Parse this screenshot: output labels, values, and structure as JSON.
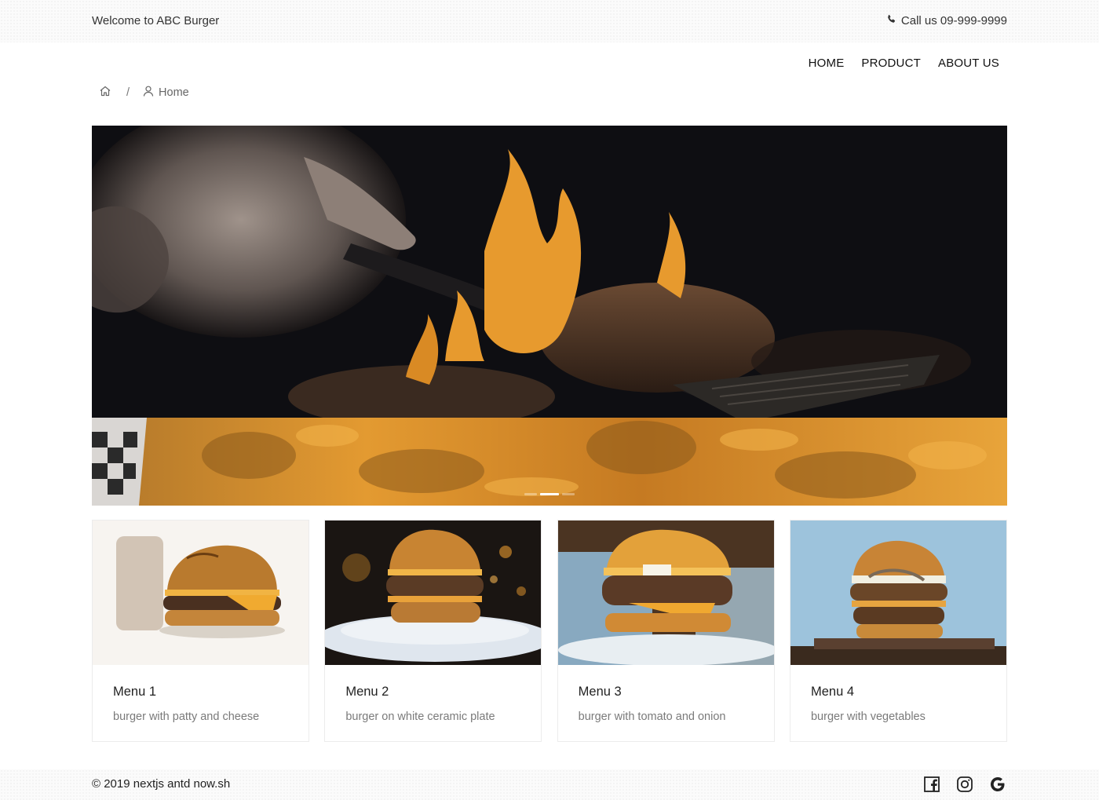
{
  "topbar": {
    "welcome": "Welcome to ABC Burger",
    "phone": "Call us 09-999-9999"
  },
  "nav": {
    "items": [
      "HOME",
      "PRODUCT",
      "ABOUT US"
    ]
  },
  "breadcrumb": {
    "separator": "/",
    "current": "Home"
  },
  "carousel": {
    "slide_count": 3,
    "active_index": 1
  },
  "cards": [
    {
      "title": "Menu 1",
      "description": "burger with patty and cheese"
    },
    {
      "title": "Menu 2",
      "description": "burger on white ceramic plate"
    },
    {
      "title": "Menu 3",
      "description": "burger with tomato and onion"
    },
    {
      "title": "Menu 4",
      "description": "burger with vegetables"
    }
  ],
  "footer": {
    "copyright": "© 2019 nextjs antd now.sh",
    "social": [
      "facebook-icon",
      "instagram-icon",
      "google-icon"
    ]
  },
  "colors": {
    "accent_orange": "#e79a2e",
    "hero_dark": "#0e0e12"
  }
}
